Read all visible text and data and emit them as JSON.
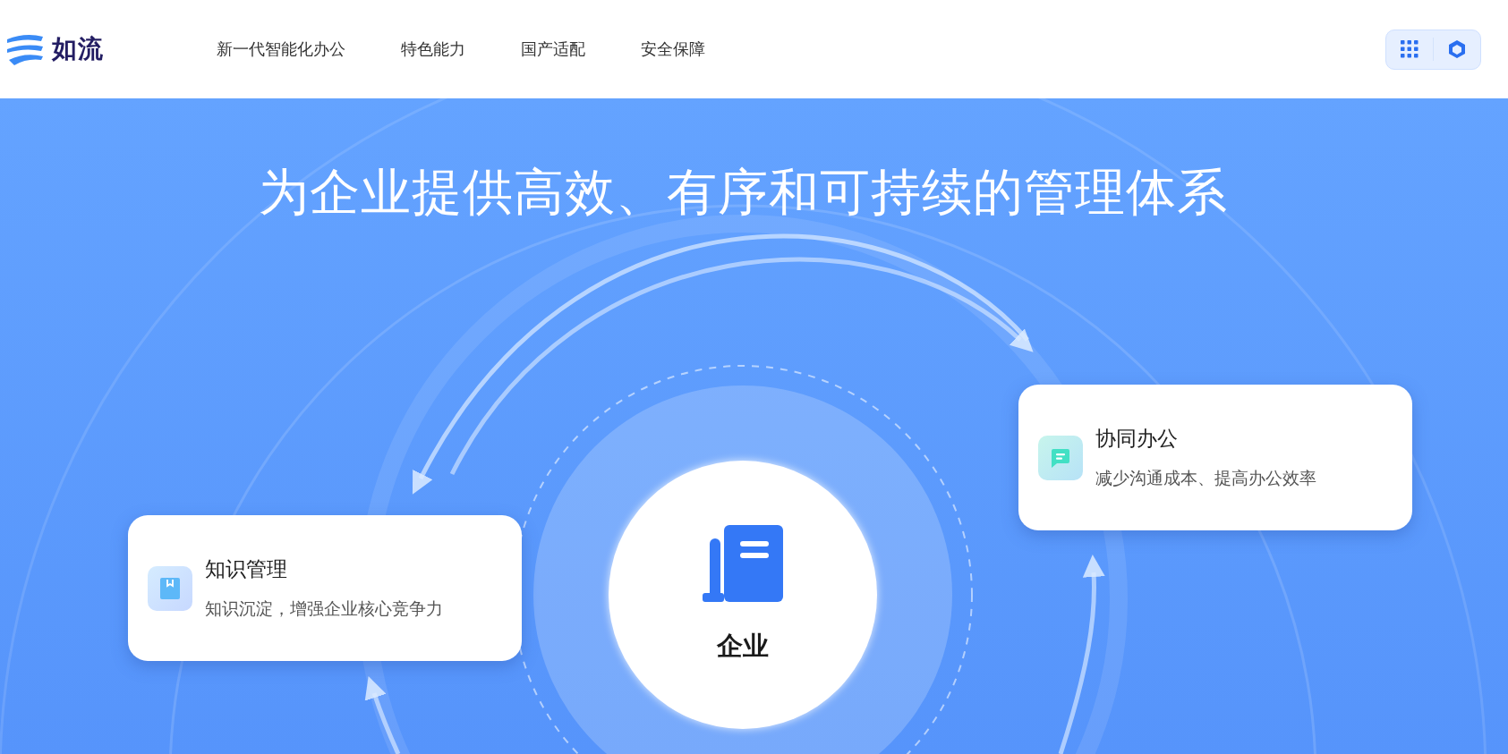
{
  "logo": {
    "text": "如流"
  },
  "nav": [
    {
      "label": "新一代智能化办公"
    },
    {
      "label": "特色能力"
    },
    {
      "label": "国产适配"
    },
    {
      "label": "安全保障"
    }
  ],
  "headline": "为企业提供高效、有序和可持续的管理体系",
  "center": {
    "label": "企业"
  },
  "cards": [
    {
      "kind": "collab",
      "title": "协同办公",
      "description": "减少沟通成本、提高办公效率"
    },
    {
      "kind": "knowledge",
      "title": "知识管理",
      "description": "知识沉淀，增强企业核心竞争力"
    }
  ]
}
